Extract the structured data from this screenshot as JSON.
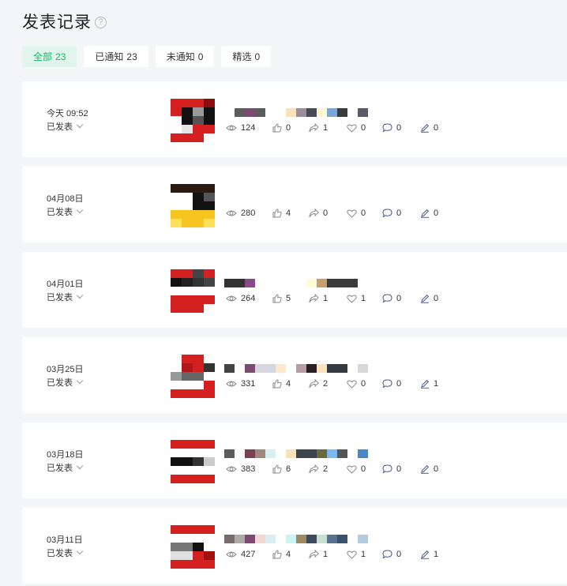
{
  "header": {
    "title": "发表记录",
    "help_icon": "help-circle-icon"
  },
  "filters": [
    {
      "label": "全部",
      "count": "23",
      "active": true
    },
    {
      "label": "已通知",
      "count": "23",
      "active": false
    },
    {
      "label": "未通知",
      "count": "0",
      "active": false
    },
    {
      "label": "精选",
      "count": "0",
      "active": false
    }
  ],
  "colors": {
    "accent": "#07c160",
    "accent_bg": "#e2f5ec",
    "page_bg": "#f4f5f7",
    "stat_icon": "#8a8a8a",
    "edit_icon": "#4a5a9a"
  },
  "posts": [
    {
      "date": "今天 09:52",
      "status": "已发表",
      "views": "124",
      "likes": "0",
      "shares": "1",
      "favorites": "0",
      "comments": "0",
      "edits": "0",
      "title_blocks": [
        "#ffffff",
        "#5c5c5c",
        "#7c4a72",
        "#5c5c5c",
        "#ffffff",
        "#ffffff",
        "#fbe2b8",
        "#9d8d9c",
        "#4a4a55",
        "#fff8d0",
        "#7aa8d6",
        "#3b3b3b",
        "#ffffff",
        "#5a5a6a"
      ],
      "thumb": [
        "#d42020",
        "#d42020",
        "#d42020",
        "#8a0e10",
        "#d42020",
        "#111111",
        "#9a9a9a",
        "#111111",
        "#ffffff",
        "#111111",
        "#555555",
        "#111111",
        "#ffffff",
        "#e5e5e5",
        "#d42020",
        "#d42020",
        "#d42020",
        "#d42020",
        "#d42020",
        "#ffffff"
      ]
    },
    {
      "date": "04月08日",
      "status": "已发表",
      "views": "280",
      "likes": "4",
      "shares": "0",
      "favorites": "0",
      "comments": "0",
      "edits": "0",
      "title_blocks": [],
      "thumb": [
        "#2a1a10",
        "#2a1a10",
        "#2a1a10",
        "#2a1a10",
        "#ffffff",
        "#ffffff",
        "#111111",
        "#555555",
        "#ffffff",
        "#ffffff",
        "#111111",
        "#111111",
        "#f7c520",
        "#f7c520",
        "#f7c520",
        "#f7c520",
        "#ffe05a",
        "#f7c520",
        "#f7c520",
        "#ffe05a"
      ]
    },
    {
      "date": "04月01日",
      "status": "已发表",
      "views": "264",
      "likes": "5",
      "shares": "1",
      "favorites": "1",
      "comments": "0",
      "edits": "0",
      "title_blocks": [
        "#333333",
        "#333333",
        "#8a4a8a",
        "#ffffff",
        "#ffffff",
        "#ffffff",
        "#ffffff",
        "#ffffff",
        "#fffad8",
        "#c8a070",
        "#3a3a3a",
        "#3a3a3a",
        "#3a3a3a"
      ],
      "thumb": [
        "#d42020",
        "#d42020",
        "#444444",
        "#d42020",
        "#111111",
        "#222222",
        "#333333",
        "#444444",
        "#ffffff",
        "#ffffff",
        "#ffffff",
        "#ffffff",
        "#d42020",
        "#d42020",
        "#d42020",
        "#d42020",
        "#d42020",
        "#d42020",
        "#d42020",
        "#ffffff"
      ]
    },
    {
      "date": "03月25日",
      "status": "已发表",
      "views": "331",
      "likes": "4",
      "shares": "2",
      "favorites": "0",
      "comments": "0",
      "edits": "1",
      "title_blocks": [
        "#444444",
        "#ffffff",
        "#7c4a72",
        "#d6d6de",
        "#d6d6de",
        "#fde8cc",
        "#ffffff",
        "#b89ca6",
        "#2a2022",
        "#fbe2b8",
        "#333a44",
        "#333a44",
        "#ffffff",
        "#d8d8d8"
      ],
      "thumb": [
        "#ffffff",
        "#d42020",
        "#d42020",
        "#ffffff",
        "#ffffff",
        "#b01818",
        "#d42020",
        "#333333",
        "#999999",
        "#666666",
        "#666666",
        "#ffffff",
        "#ffffff",
        "#ffffff",
        "#ffffff",
        "#d42020",
        "#d42020",
        "#d42020",
        "#d42020",
        "#d42020"
      ]
    },
    {
      "date": "03月18日",
      "status": "已发表",
      "views": "383",
      "likes": "6",
      "shares": "2",
      "favorites": "0",
      "comments": "0",
      "edits": "0",
      "title_blocks": [
        "#5c5c5c",
        "#ffffff",
        "#7c4050",
        "#a08880",
        "#d8eef0",
        "#ffffff",
        "#fbe2b8",
        "#3c4450",
        "#3c4450",
        "#6a6a3a",
        "#7ab8f0",
        "#555555",
        "#ffffff",
        "#4a88cc"
      ],
      "thumb": [
        "#d42020",
        "#d42020",
        "#d42020",
        "#d42020",
        "#ffffff",
        "#ffffff",
        "#ffffff",
        "#ffffff",
        "#111111",
        "#111111",
        "#333333",
        "#cccccc",
        "#ffffff",
        "#ffffff",
        "#ffffff",
        "#ffffff",
        "#d42020",
        "#d42020",
        "#d42020",
        "#d42020"
      ]
    },
    {
      "date": "03月11日",
      "status": "已发表",
      "views": "427",
      "likes": "4",
      "shares": "1",
      "favorites": "1",
      "comments": "0",
      "edits": "1",
      "title_blocks": [
        "#7a6a6a",
        "#aaaaaa",
        "#7c4a72",
        "#f0d8d0",
        "#d8eef0",
        "#ffffff",
        "#c8f4f4",
        "#a08860",
        "#3c4a5a",
        "#c8e0d0",
        "#5a7090",
        "#3c5070",
        "#ffffff",
        "#b0cce0"
      ],
      "thumb": [
        "#d42020",
        "#d42020",
        "#d42020",
        "#d42020",
        "#ffffff",
        "#ffffff",
        "#ffffff",
        "#ffffff",
        "#777777",
        "#777777",
        "#111111",
        "#ffffff",
        "#e0e0e0",
        "#e0e0e0",
        "#d42020",
        "#a01010",
        "#d42020",
        "#d42020",
        "#d42020",
        "#d42020"
      ]
    }
  ]
}
